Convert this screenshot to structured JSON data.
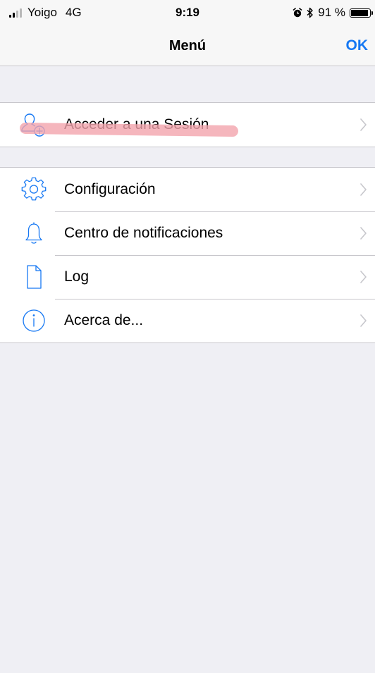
{
  "status_bar": {
    "carrier": "Yoigo",
    "network": "4G",
    "time": "9:19",
    "battery": "91 %",
    "battery_level": 0.91,
    "icons": [
      "signal-icon",
      "alarm-icon",
      "bluetooth-icon",
      "battery-icon"
    ]
  },
  "nav": {
    "title": "Menú",
    "done_label": "OK",
    "accent_color": "#1678f3"
  },
  "menu": {
    "session_group": [
      {
        "label": "Acceder a una Sesión",
        "icon": "add-user-icon"
      }
    ],
    "main_group": [
      {
        "label": "Configuración",
        "icon": "gear-icon"
      },
      {
        "label": "Centro de notificaciones",
        "icon": "bell-icon"
      },
      {
        "label": "Log",
        "icon": "document-icon"
      },
      {
        "label": "Acerca de...",
        "icon": "info-icon"
      }
    ]
  },
  "annotation_color": "#f3a4ad"
}
